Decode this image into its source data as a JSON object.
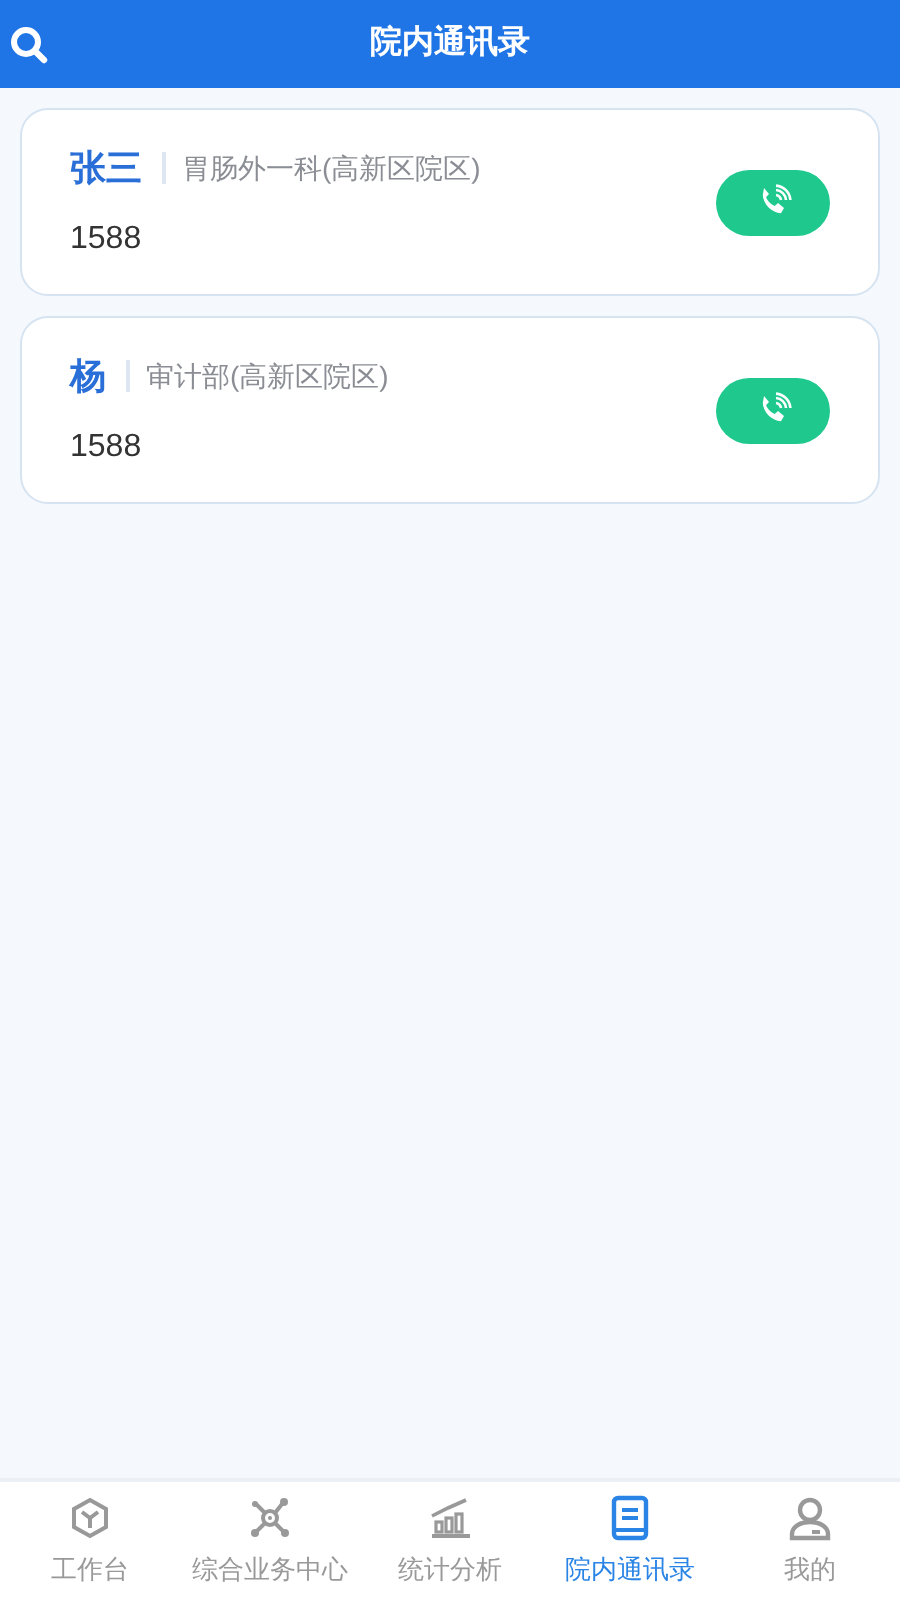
{
  "header": {
    "title": "院内通讯录"
  },
  "contacts": [
    {
      "name": "张三",
      "department": "胃肠外一科(高新区院区)",
      "phone": "1588"
    },
    {
      "name": "杨",
      "department": "审计部(高新区院区)",
      "phone": "1588"
    }
  ],
  "tabs": [
    {
      "label": "工作台",
      "selected": false
    },
    {
      "label": "综合业务中心",
      "selected": false
    },
    {
      "label": "统计分析",
      "selected": false
    },
    {
      "label": "院内通讯录",
      "selected": true
    },
    {
      "label": "我的",
      "selected": false
    }
  ]
}
